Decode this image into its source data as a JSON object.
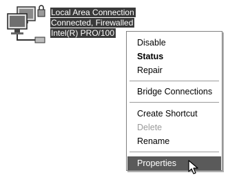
{
  "connection": {
    "icon": "network-connection-icon",
    "name": "Local Area Connection",
    "status": "Connected, Firewalled",
    "device": "Intel(R) PRO/100"
  },
  "context_menu": {
    "items": [
      {
        "label": "Disable",
        "bold": false,
        "enabled": true,
        "highlighted": false
      },
      {
        "label": "Status",
        "bold": true,
        "enabled": true,
        "highlighted": false
      },
      {
        "label": "Repair",
        "bold": false,
        "enabled": true,
        "highlighted": false
      },
      {
        "label": "Bridge Connections",
        "bold": false,
        "enabled": true,
        "highlighted": false
      },
      {
        "label": "Create Shortcut",
        "bold": false,
        "enabled": true,
        "highlighted": false
      },
      {
        "label": "Delete",
        "bold": false,
        "enabled": false,
        "highlighted": false
      },
      {
        "label": "Rename",
        "bold": false,
        "enabled": true,
        "highlighted": false
      },
      {
        "label": "Properties",
        "bold": false,
        "enabled": true,
        "highlighted": true
      }
    ]
  },
  "cursor": {
    "icon": "arrow-cursor-icon"
  }
}
